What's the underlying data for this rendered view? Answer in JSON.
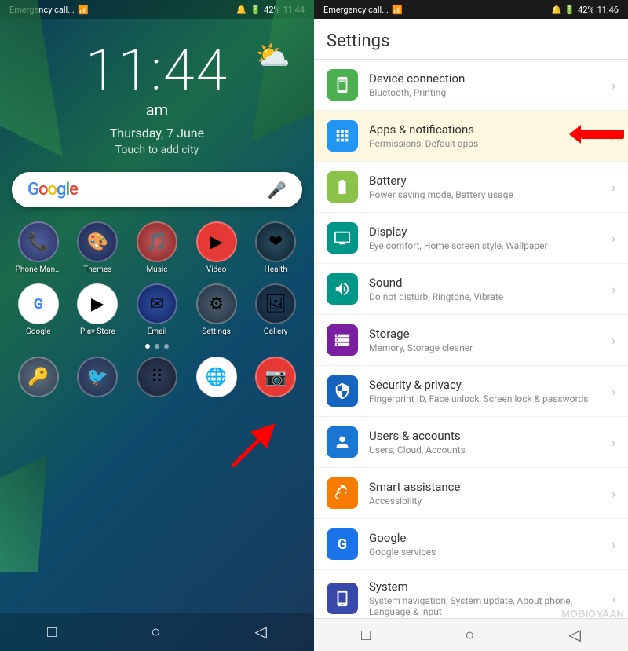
{
  "left": {
    "status_bar": {
      "left": "Emergency call...",
      "battery": "42%",
      "time": "11:44"
    },
    "clock": {
      "time": "11:44",
      "am_pm": "am",
      "date": "Thursday, 7 June",
      "city_prompt": "Touch to add city"
    },
    "search": {
      "placeholder": "Google",
      "mic_label": "microphone"
    },
    "apps_row1": [
      {
        "label": "Phone Man...",
        "icon": "📞"
      },
      {
        "label": "Themes",
        "icon": "🎨"
      },
      {
        "label": "Music",
        "icon": "🎵"
      },
      {
        "label": "Video",
        "icon": "▶"
      },
      {
        "label": "Health",
        "icon": "❤"
      }
    ],
    "apps_row2": [
      {
        "label": "Google",
        "icon": "G"
      },
      {
        "label": "Play Store",
        "icon": "▶"
      },
      {
        "label": "Email",
        "icon": "✉"
      },
      {
        "label": "Settings",
        "icon": "⚙"
      },
      {
        "label": "Gallery",
        "icon": "🖼"
      }
    ],
    "apps_row3": [
      {
        "label": "",
        "icon": "🔑"
      },
      {
        "label": "",
        "icon": "📝"
      },
      {
        "label": "",
        "icon": "⠿"
      },
      {
        "label": "",
        "icon": "🌐"
      },
      {
        "label": "",
        "icon": "📷"
      }
    ],
    "nav": {
      "back": "◁",
      "home": "○",
      "recents": "□"
    }
  },
  "right": {
    "status_bar": {
      "left": "Emergency call...",
      "battery": "42%",
      "time": "11:46"
    },
    "title": "Settings",
    "items": [
      {
        "name": "Device connection",
        "sub": "Bluetooth, Printing",
        "icon": "📡",
        "icon_color": "icon-green"
      },
      {
        "name": "Apps & notifications",
        "sub": "Permissions, Default apps",
        "icon": "📱",
        "icon_color": "icon-blue",
        "highlighted": true
      },
      {
        "name": "Battery",
        "sub": "Power saving mode, Battery usage",
        "icon": "🔋",
        "icon_color": "icon-lime"
      },
      {
        "name": "Display",
        "sub": "Eye comfort, Home screen style, Wallpaper",
        "icon": "🖥",
        "icon_color": "icon-teal"
      },
      {
        "name": "Sound",
        "sub": "Do not disturb, Ringtone, Vibrate",
        "icon": "🔊",
        "icon_color": "icon-teal"
      },
      {
        "name": "Storage",
        "sub": "Memory, Storage cleaner",
        "icon": "💾",
        "icon_color": "icon-purple"
      },
      {
        "name": "Security & privacy",
        "sub": "Fingerprint ID, Face unlock, Screen lock & passwords",
        "icon": "🔒",
        "icon_color": "icon-indigo"
      },
      {
        "name": "Users & accounts",
        "sub": "Users, Cloud, Accounts",
        "icon": "👤",
        "icon_color": "icon-blue"
      },
      {
        "name": "Smart assistance",
        "sub": "Accessibility",
        "icon": "🤚",
        "icon_color": "icon-orange"
      },
      {
        "name": "Google",
        "sub": "Google services",
        "icon": "G",
        "icon_color": "icon-dark-blue"
      },
      {
        "name": "System",
        "sub": "System navigation, System update, About phone, Language & input",
        "icon": "📱",
        "icon_color": "icon-indigo"
      }
    ],
    "nav": {
      "back": "◁",
      "home": "○",
      "recents": "□"
    }
  },
  "watermark": "MOBIGYAAN"
}
